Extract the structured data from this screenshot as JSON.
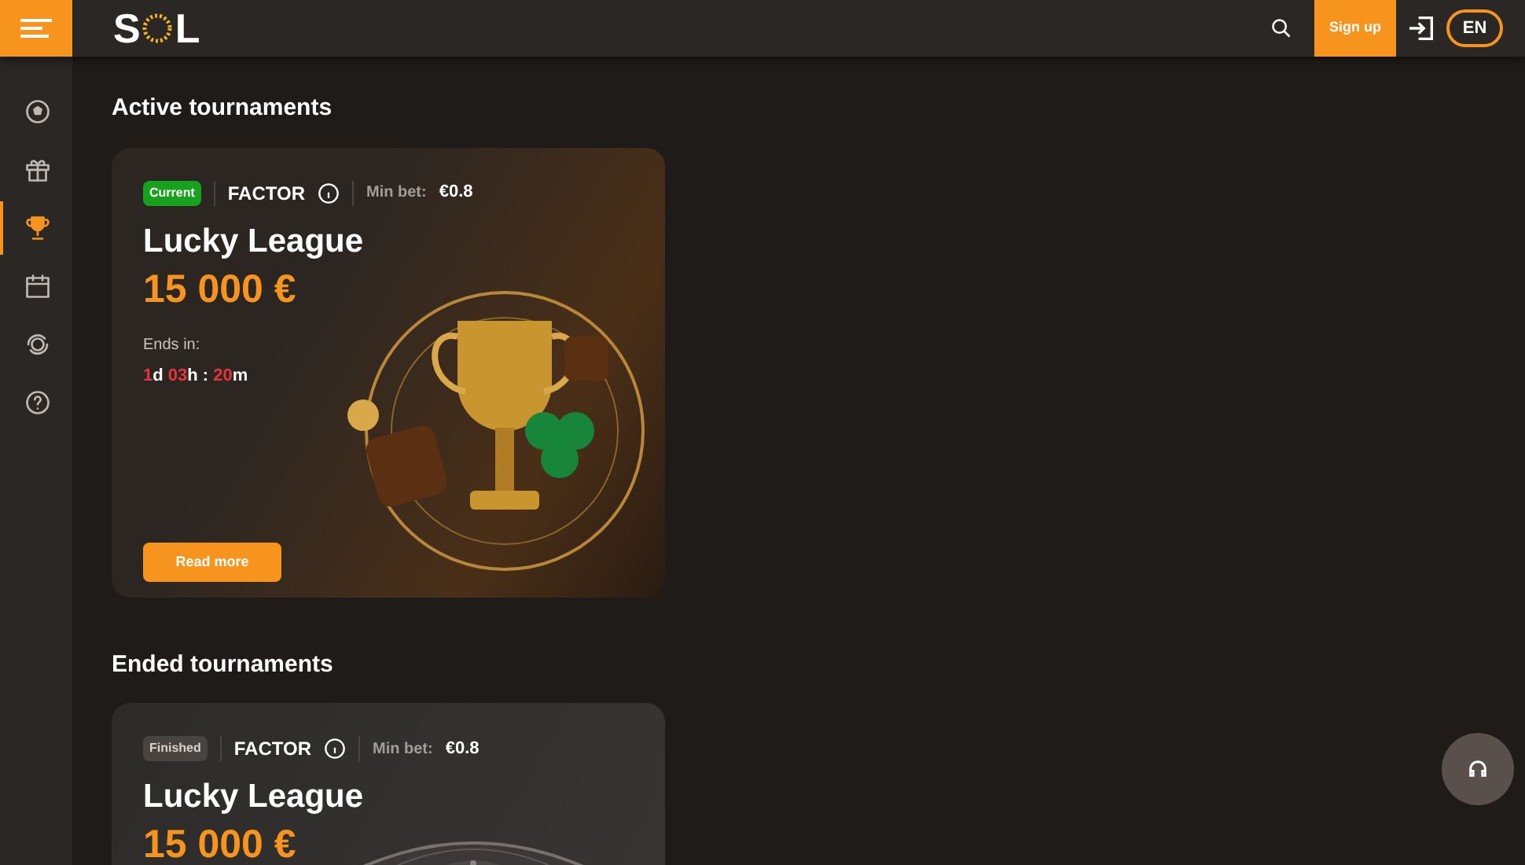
{
  "header": {
    "logo": {
      "left": "S",
      "right": "L"
    },
    "signup": "Sign up",
    "language": "EN"
  },
  "sidebar": {
    "items": [
      {
        "kind": "ball",
        "selected": false
      },
      {
        "kind": "gift",
        "selected": false
      },
      {
        "kind": "trophy",
        "selected": true
      },
      {
        "kind": "calendar",
        "selected": false
      },
      {
        "kind": "support24",
        "selected": false
      },
      {
        "kind": "help",
        "selected": false
      }
    ]
  },
  "sections": [
    {
      "title": "Active tournaments",
      "card": {
        "status": {
          "kind": "current",
          "label": "Current"
        },
        "type": "FACTOR",
        "min_bet_label": "Min bet:",
        "min_bet": "€0.8",
        "name": "Lucky League",
        "prize": "15 000 €",
        "ends_label": "Ends in:",
        "countdown": [
          {
            "text": "1",
            "kind": "value"
          },
          {
            "text": "d ",
            "kind": "unit"
          },
          {
            "text": "03",
            "kind": "value"
          },
          {
            "text": "h : ",
            "kind": "unit"
          },
          {
            "text": "20",
            "kind": "value"
          },
          {
            "text": "m",
            "kind": "unit"
          }
        ],
        "button": "Read more"
      }
    },
    {
      "title": "Ended tournaments",
      "card": {
        "status": {
          "kind": "finished",
          "label": "Finished"
        },
        "type": "FACTOR",
        "min_bet_label": "Min bet:",
        "min_bet": "€0.8",
        "name": "Lucky League",
        "prize": "15 000 €"
      }
    }
  ]
}
